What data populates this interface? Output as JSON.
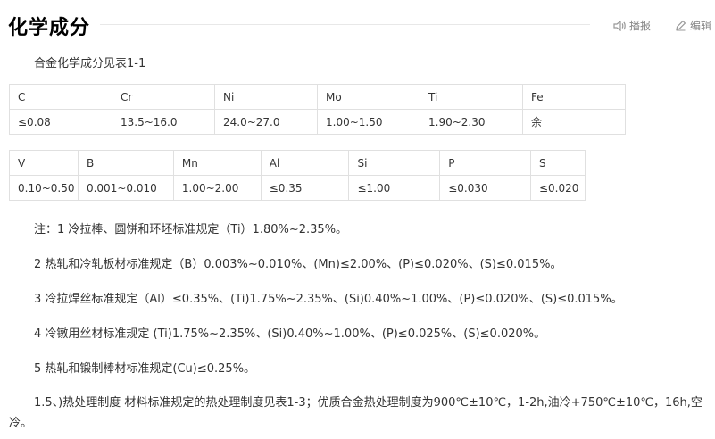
{
  "header": {
    "title": "化学成分",
    "broadcast_label": "播报",
    "edit_label": "编辑"
  },
  "intro": "合金化学成分见表1-1",
  "table1": {
    "headers": [
      "C",
      "Cr",
      "Ni",
      "Mo",
      "Ti",
      "Fe"
    ],
    "values": [
      "≤0.08",
      "13.5~16.0",
      "24.0~27.0",
      "1.00~1.50",
      "1.90~2.30",
      "余"
    ]
  },
  "table2": {
    "headers": [
      "V",
      "B",
      "Mn",
      "Al",
      "Si",
      "P",
      "S"
    ],
    "values": [
      "0.10~0.50",
      "0.001~0.010",
      "1.00~2.00",
      "≤0.35",
      "≤1.00",
      "≤0.030",
      "≤0.020"
    ]
  },
  "notes": [
    "注：1 冷拉棒、圆饼和环坯标准规定（Ti）1.80%~2.35%。",
    "2 热轧和冷轧板材标准规定（B）0.003%~0.010%、(Mn)≤2.00%、(P)≤0.020%、(S)≤0.015%。",
    "3 冷拉焊丝标准规定（Al）≤0.35%、(Ti)1.75%~2.35%、(Si)0.40%~1.00%、(P)≤0.020%、(S)≤0.015%。",
    "4 冷镦用丝材标准规定 (Ti)1.75%~2.35%、(Si)0.40%~1.00%、(P)≤0.025%、(S)≤0.020%。",
    "5 热轧和锻制棒材标准规定(Cu)≤0.25%。",
    "1.5、)热处理制度 材料标准规定的热处理制度见表1-3；优质合金热处理制度为900℃±10℃，1-2h,油冷+750℃±10℃，16h,空冷。"
  ]
}
